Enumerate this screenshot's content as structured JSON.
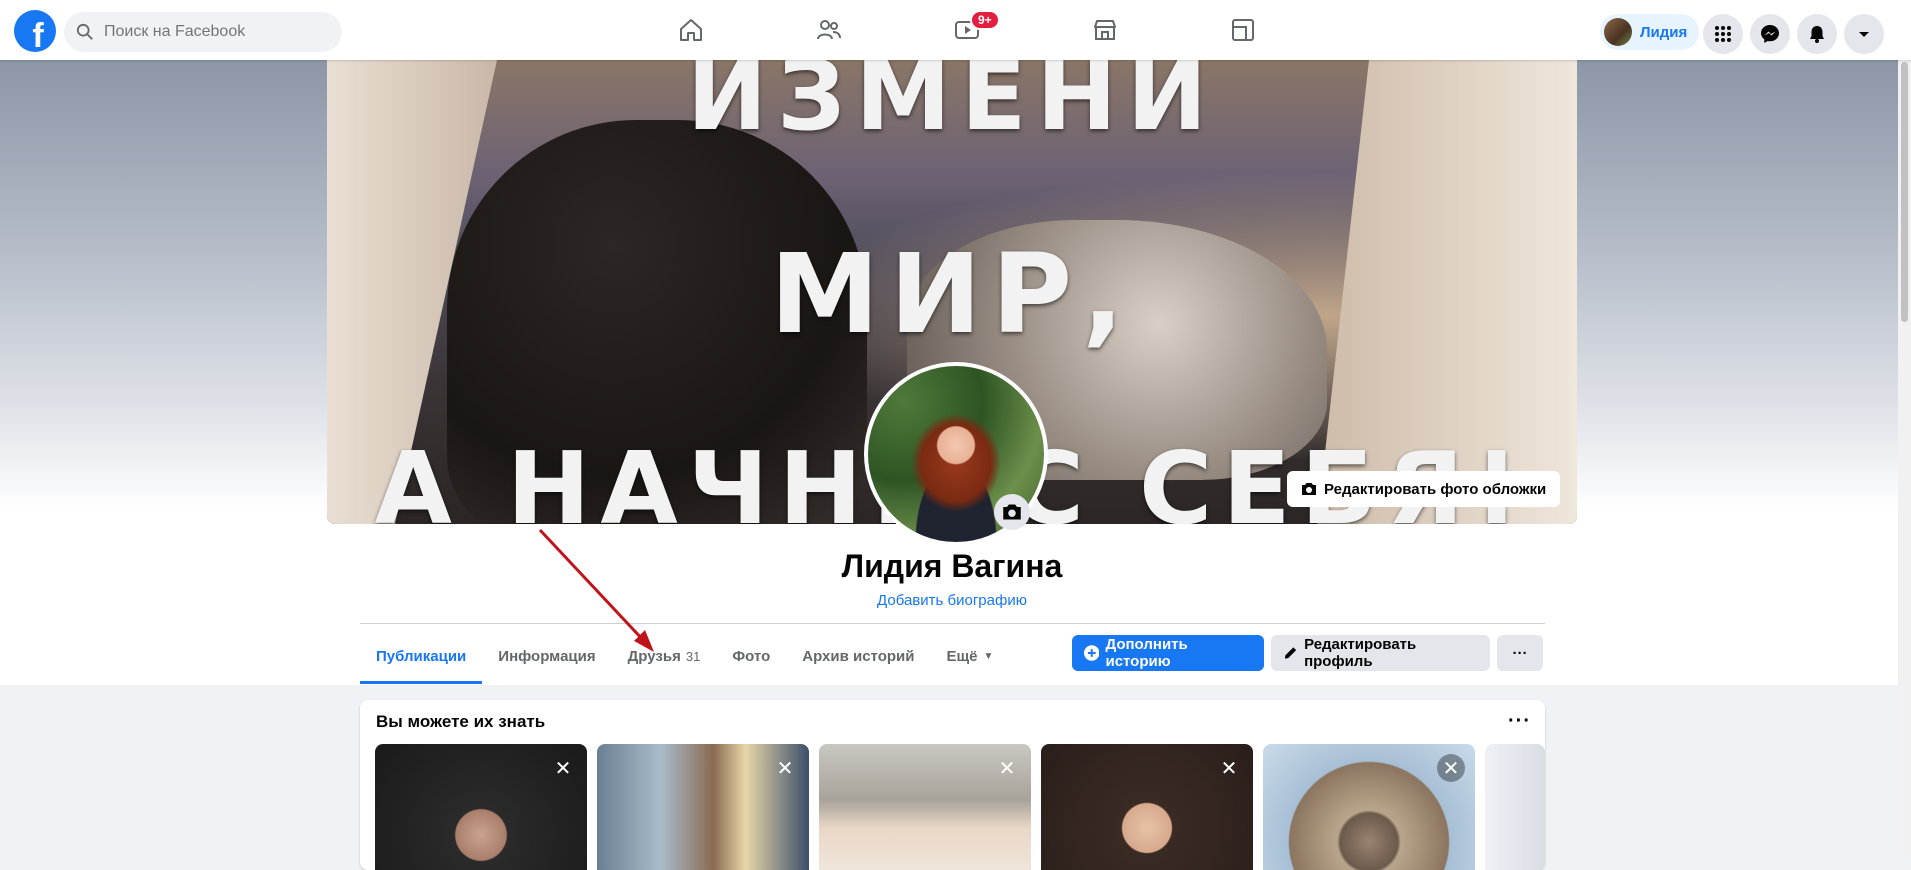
{
  "topbar": {
    "logo_letter": "f",
    "search_placeholder": "Поиск на Facebook",
    "nav": [
      {
        "name": "home",
        "icon": "home-icon"
      },
      {
        "name": "friends",
        "icon": "friends-icon"
      },
      {
        "name": "watch",
        "icon": "video-icon",
        "badge": "9+"
      },
      {
        "name": "marketplace",
        "icon": "store-icon"
      },
      {
        "name": "gaming",
        "icon": "gaming-icon"
      }
    ],
    "profile_name": "Лидия",
    "right_icons": [
      "menu-grid-icon",
      "messenger-icon",
      "notifications-icon",
      "account-caret-icon"
    ]
  },
  "cover": {
    "poster_lines": [
      "ИЗМЕНИ",
      "МИР,",
      "А НАЧНИ С СЕБЯ!"
    ],
    "edit_cover_label": "Редактировать фото обложки"
  },
  "profile": {
    "name": "Лидия Вагина",
    "add_bio_label": "Добавить биографию"
  },
  "tabs": [
    {
      "label": "Публикации",
      "active": true
    },
    {
      "label": "Информация"
    },
    {
      "label": "Друзья",
      "count": "31"
    },
    {
      "label": "Фото"
    },
    {
      "label": "Архив историй"
    },
    {
      "label": "Ещё",
      "caret": "▼"
    }
  ],
  "actions": {
    "add_story": "Дополнить историю",
    "edit_profile": "Редактировать профиль",
    "more": "···"
  },
  "suggestions": {
    "title": "Вы можете их знать",
    "more": "···",
    "close_glyph": "✕",
    "card_count_visible": 6
  },
  "colors": {
    "accent": "#1877f2",
    "annotation_arrow": "#c0141b",
    "badge": "#e41e3f"
  }
}
